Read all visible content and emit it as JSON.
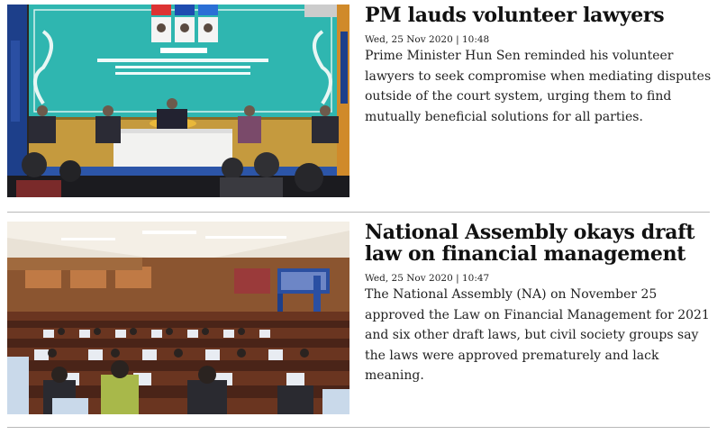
{
  "articles": [
    {
      "headline": "PM lauds volunteer lawyers",
      "meta": "Wed, 25 Nov 2020 | 10:48",
      "summary": "Prime Minister Hun Sen reminded his volunteer lawyers to seek compromise when mediating disputes outside of the court system, urging them to find mutually beneficial solutions for all parties.",
      "image_desc_icon": "photo-ceremony"
    },
    {
      "headline": "National Assembly okays draft law on financial management",
      "meta": "Wed, 25 Nov 2020 | 10:47",
      "summary": "The National Assembly (NA) on November 25 approved the Law on Financial Management for 2021 and six other draft laws, but civil society groups say the laws were approved prematurely and lack meaning.",
      "image_desc_icon": "photo-assembly-hall"
    }
  ],
  "colors": {
    "headline": "#111111",
    "banner_teal": "#2fb6b0",
    "divider": "#b9b9b9"
  }
}
